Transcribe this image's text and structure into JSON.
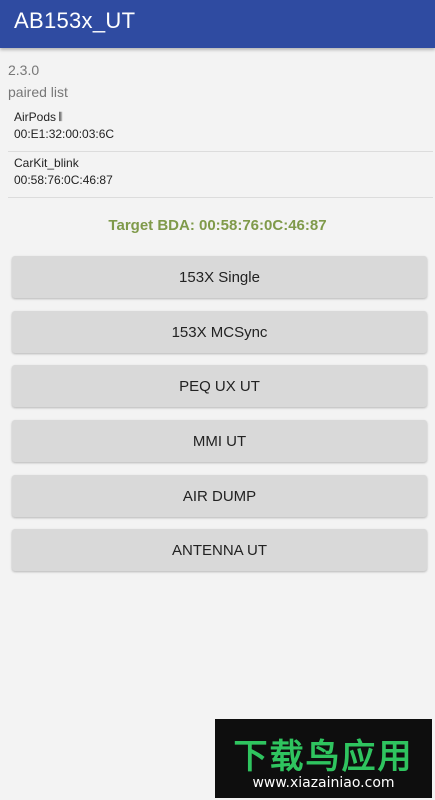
{
  "app_bar": {
    "title": "AB153x_UT",
    "color": "#2f4ba1"
  },
  "version": "2.3.0",
  "paired_list": {
    "label": "paired list",
    "devices": [
      {
        "name": "AirPods 𝄃",
        "address": "00:E1:32:00:03:6C"
      },
      {
        "name": "CarKit_blink",
        "address": "00:58:76:0C:46:87"
      }
    ]
  },
  "target_bda": {
    "text": "Target BDA: 00:58:76:0C:46:87",
    "color": "#7f9a4a"
  },
  "buttons": [
    {
      "label": "153X Single"
    },
    {
      "label": "153X MCSync"
    },
    {
      "label": "PEQ UX UT"
    },
    {
      "label": "MMI UT"
    },
    {
      "label": "AIR DUMP"
    },
    {
      "label": "ANTENNA UT"
    }
  ],
  "watermark": {
    "brand": "下载鸟应用",
    "url": "www.xiazainiao.com"
  }
}
